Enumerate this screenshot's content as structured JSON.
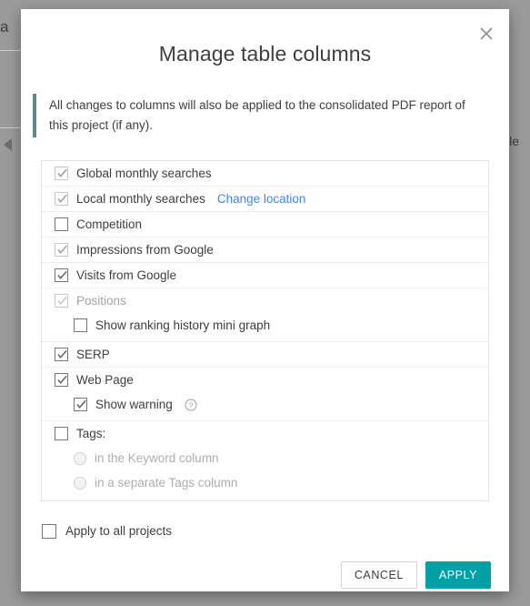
{
  "backdrop": {
    "left_text_fragment": "a",
    "right_text_fragment": "gle"
  },
  "dialog": {
    "title": "Manage table columns",
    "close_label": "×",
    "notice": "All changes to columns will also be applied to the consolidated PDF report of this project (if any).",
    "accent_color": "#628889",
    "link_color": "#4285f4",
    "apply_color": "#00a0a6"
  },
  "columns": [
    {
      "label": "Global monthly searches",
      "checked": true,
      "disabled": true,
      "indent": false,
      "link": null
    },
    {
      "label": "Local monthly searches",
      "checked": true,
      "disabled": true,
      "indent": false,
      "link": "Change location"
    },
    {
      "label": "Competition",
      "checked": false,
      "disabled": false,
      "indent": false,
      "link": null
    },
    {
      "label": "Impressions from Google",
      "checked": true,
      "disabled": true,
      "indent": false,
      "link": null
    },
    {
      "label": "Visits from Google",
      "checked": true,
      "disabled": false,
      "indent": false,
      "link": null
    },
    {
      "label": "Positions",
      "checked": true,
      "disabled": true,
      "indent": false,
      "link": null
    },
    {
      "label": "Show ranking history mini graph",
      "checked": false,
      "disabled": false,
      "indent": true,
      "link": null
    },
    {
      "label": "SERP",
      "checked": true,
      "disabled": false,
      "indent": false,
      "link": null
    },
    {
      "label": "Web Page",
      "checked": true,
      "disabled": false,
      "indent": false,
      "link": null
    },
    {
      "label": "Show warning",
      "checked": true,
      "disabled": false,
      "indent": true,
      "link": null,
      "help": "help-icon"
    },
    {
      "label": "Tags:",
      "checked": false,
      "disabled": false,
      "indent": false,
      "link": null
    }
  ],
  "tags_options": [
    {
      "label": "in the Keyword column",
      "selected": false,
      "disabled": true
    },
    {
      "label": "in a separate Tags column",
      "selected": false,
      "disabled": true
    }
  ],
  "footer": {
    "apply_all_label": "Apply to all projects",
    "apply_all_checked": false,
    "cancel_label": "CANCEL",
    "apply_label": "APPLY"
  }
}
